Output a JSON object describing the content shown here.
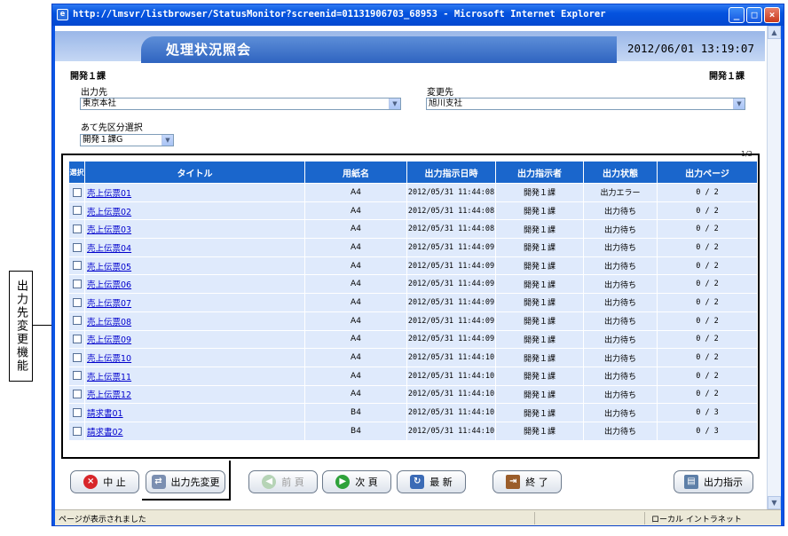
{
  "callout": "出力先変更機能",
  "window": {
    "title": "http://lmsvr/listbrowser/StatusMonitor?screenid=01131906703_68953 - Microsoft Internet Explorer"
  },
  "header": {
    "page_title": "処理状況照会",
    "datetime": "2012/06/01 13:19:07"
  },
  "dept_left": "開発１課",
  "dept_right": "開発１課",
  "form": {
    "output_dest_label": "出力先",
    "output_dest_value": "東京本社",
    "change_dest_label": "変更先",
    "change_dest_value": "旭川支社",
    "category_label": "あて先区分選択",
    "category_value": "開発１課G"
  },
  "page_indicator": "1/2",
  "table": {
    "headers": [
      "選択",
      "タイトル",
      "用紙名",
      "出力指示日時",
      "出力指示者",
      "出力状態",
      "出力ページ"
    ],
    "rows": [
      {
        "title": "売上伝票01",
        "paper": "A4",
        "datetime": "2012/05/31 11:44:08",
        "user": "開発１課",
        "status": "出力エラー",
        "pages": "0 / 2"
      },
      {
        "title": "売上伝票02",
        "paper": "A4",
        "datetime": "2012/05/31 11:44:08",
        "user": "開発１課",
        "status": "出力待ち",
        "pages": "0 / 2"
      },
      {
        "title": "売上伝票03",
        "paper": "A4",
        "datetime": "2012/05/31 11:44:08",
        "user": "開発１課",
        "status": "出力待ち",
        "pages": "0 / 2"
      },
      {
        "title": "売上伝票04",
        "paper": "A4",
        "datetime": "2012/05/31 11:44:09",
        "user": "開発１課",
        "status": "出力待ち",
        "pages": "0 / 2"
      },
      {
        "title": "売上伝票05",
        "paper": "A4",
        "datetime": "2012/05/31 11:44:09",
        "user": "開発１課",
        "status": "出力待ち",
        "pages": "0 / 2"
      },
      {
        "title": "売上伝票06",
        "paper": "A4",
        "datetime": "2012/05/31 11:44:09",
        "user": "開発１課",
        "status": "出力待ち",
        "pages": "0 / 2"
      },
      {
        "title": "売上伝票07",
        "paper": "A4",
        "datetime": "2012/05/31 11:44:09",
        "user": "開発１課",
        "status": "出力待ち",
        "pages": "0 / 2"
      },
      {
        "title": "売上伝票08",
        "paper": "A4",
        "datetime": "2012/05/31 11:44:09",
        "user": "開発１課",
        "status": "出力待ち",
        "pages": "0 / 2"
      },
      {
        "title": "売上伝票09",
        "paper": "A4",
        "datetime": "2012/05/31 11:44:09",
        "user": "開発１課",
        "status": "出力待ち",
        "pages": "0 / 2"
      },
      {
        "title": "売上伝票10",
        "paper": "A4",
        "datetime": "2012/05/31 11:44:10",
        "user": "開発１課",
        "status": "出力待ち",
        "pages": "0 / 2"
      },
      {
        "title": "売上伝票11",
        "paper": "A4",
        "datetime": "2012/05/31 11:44:10",
        "user": "開発１課",
        "status": "出力待ち",
        "pages": "0 / 2"
      },
      {
        "title": "売上伝票12",
        "paper": "A4",
        "datetime": "2012/05/31 11:44:10",
        "user": "開発１課",
        "status": "出力待ち",
        "pages": "0 / 2"
      },
      {
        "title": "請求書01",
        "paper": "B4",
        "datetime": "2012/05/31 11:44:10",
        "user": "開発１課",
        "status": "出力待ち",
        "pages": "0 / 3"
      },
      {
        "title": "請求書02",
        "paper": "B4",
        "datetime": "2012/05/31 11:44:10",
        "user": "開発１課",
        "status": "出力待ち",
        "pages": "0 / 3"
      }
    ]
  },
  "buttons": {
    "stop": "中 止",
    "change_dest": "出力先変更",
    "prev": "前 頁",
    "next": "次 頁",
    "refresh": "最 新",
    "exit": "終 了",
    "print": "出力指示"
  },
  "status": {
    "left": "ページが表示されました",
    "right": "ローカル イントラネット"
  }
}
